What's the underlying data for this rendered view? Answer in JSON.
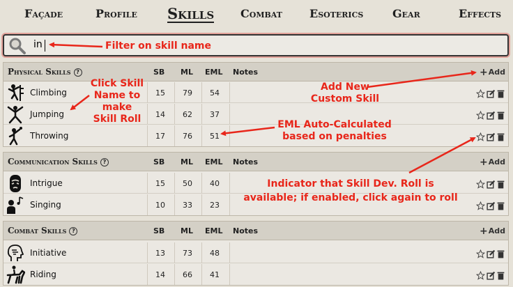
{
  "tabs": [
    {
      "label": "Façade"
    },
    {
      "label": "Profile"
    },
    {
      "label": "Skills"
    },
    {
      "label": "Combat"
    },
    {
      "label": "Esoterics"
    },
    {
      "label": "Gear"
    },
    {
      "label": "Effects"
    }
  ],
  "search": {
    "value": "in"
  },
  "columns": {
    "sb": "SB",
    "ml": "ML",
    "eml": "EML",
    "notes": "Notes"
  },
  "add_label": "Add",
  "sections": [
    {
      "title": "Physical Skills",
      "rows": [
        {
          "name": "Climbing",
          "sb": "15",
          "ml": "79",
          "eml": "54",
          "icon": "climbing-icon"
        },
        {
          "name": "Jumping",
          "sb": "14",
          "ml": "62",
          "eml": "37",
          "icon": "jumping-icon"
        },
        {
          "name": "Throwing",
          "sb": "17",
          "ml": "76",
          "eml": "51",
          "icon": "throwing-icon"
        }
      ]
    },
    {
      "title": "Communication Skills",
      "rows": [
        {
          "name": "Intrigue",
          "sb": "15",
          "ml": "50",
          "eml": "40",
          "icon": "intrigue-icon"
        },
        {
          "name": "Singing",
          "sb": "10",
          "ml": "33",
          "eml": "23",
          "icon": "singing-icon"
        }
      ]
    },
    {
      "title": "Combat Skills",
      "rows": [
        {
          "name": "Initiative",
          "sb": "13",
          "ml": "73",
          "eml": "48",
          "icon": "initiative-icon"
        },
        {
          "name": "Riding",
          "sb": "14",
          "ml": "66",
          "eml": "41",
          "icon": "riding-icon"
        }
      ]
    }
  ],
  "annotations": {
    "filter": "Filter on skill name",
    "click_skill": [
      "Click Skill",
      "Name to",
      "make",
      "Skill Roll"
    ],
    "add_new": [
      "Add New",
      "Custom Skill"
    ],
    "eml_auto": [
      "EML Auto-Calculated",
      "based on penalties"
    ],
    "indicator": [
      "Indicator that Skill Dev. Roll is",
      "available; if enabled, click again to roll"
    ]
  },
  "colors": {
    "annotation": "#e8261a",
    "header_bg": "#d4d0c6",
    "page_bg": "#e6e2d8"
  }
}
